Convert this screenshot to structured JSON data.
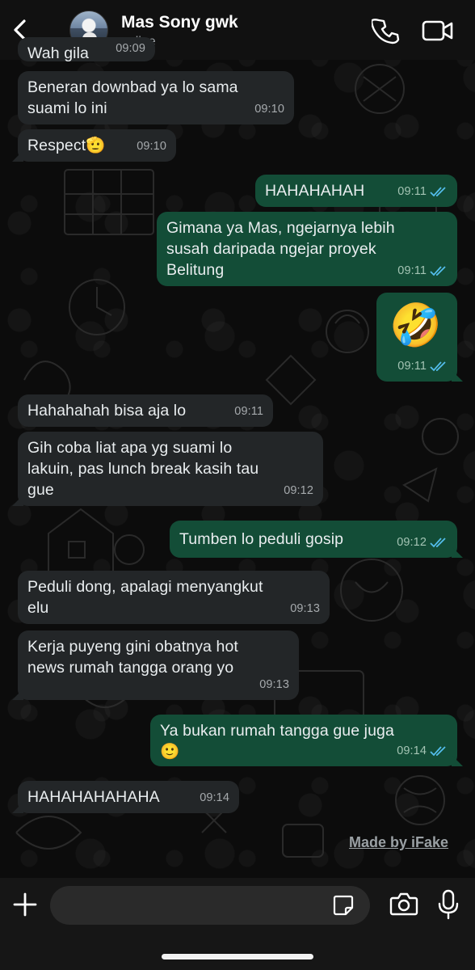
{
  "header": {
    "contact_name": "Mas Sony gwk",
    "status": "online",
    "icons": [
      "back-chevron-icon",
      "avatar",
      "phone-icon",
      "video-camera-icon"
    ]
  },
  "messages": [
    {
      "dir": "in",
      "text": "Wah gila",
      "time": "09:09"
    },
    {
      "dir": "in",
      "text": "Beneran downbad ya lo sama\nsuami lo ini",
      "time": "09:10"
    },
    {
      "dir": "in",
      "text": "Respect🫡",
      "time": "09:10"
    },
    {
      "dir": "out",
      "text": "HAHAHAHAH",
      "time": "09:11"
    },
    {
      "dir": "out",
      "text": "Gimana ya Mas, ngejarnya lebih\nsusah daripada ngejar proyek\nBelitung",
      "time": "09:11"
    },
    {
      "dir": "out",
      "text": "🤣",
      "time": "09:11"
    },
    {
      "dir": "in",
      "text": "Hahahahah bisa aja lo",
      "time": "09:11"
    },
    {
      "dir": "in",
      "text": "Gih coba liat apa yg suami lo\nlakuin, pas lunch break kasih tau\ngue",
      "time": "09:12"
    },
    {
      "dir": "out",
      "text": "Tumben lo peduli gosip",
      "time": "09:12"
    },
    {
      "dir": "in",
      "text": "Peduli dong, apalagi menyangkut\nelu",
      "time": "09:13"
    },
    {
      "dir": "in",
      "text": "Kerja puyeng gini obatnya hot\nnews rumah tangga orang yo",
      "time": "09:13"
    },
    {
      "dir": "out",
      "text": "Ya bukan rumah tangga gue juga\n🙂",
      "time": "09:14"
    },
    {
      "dir": "in",
      "text": "HAHAHAHAHAHA",
      "time": "09:14"
    }
  ],
  "watermark": "Made by iFake",
  "input": {
    "placeholder": "",
    "value": ""
  },
  "colors": {
    "incoming_bubble": "#232628",
    "outgoing_bubble": "#134d37",
    "read_ticks": "#53bdeb",
    "background": "#0c0c0c"
  }
}
